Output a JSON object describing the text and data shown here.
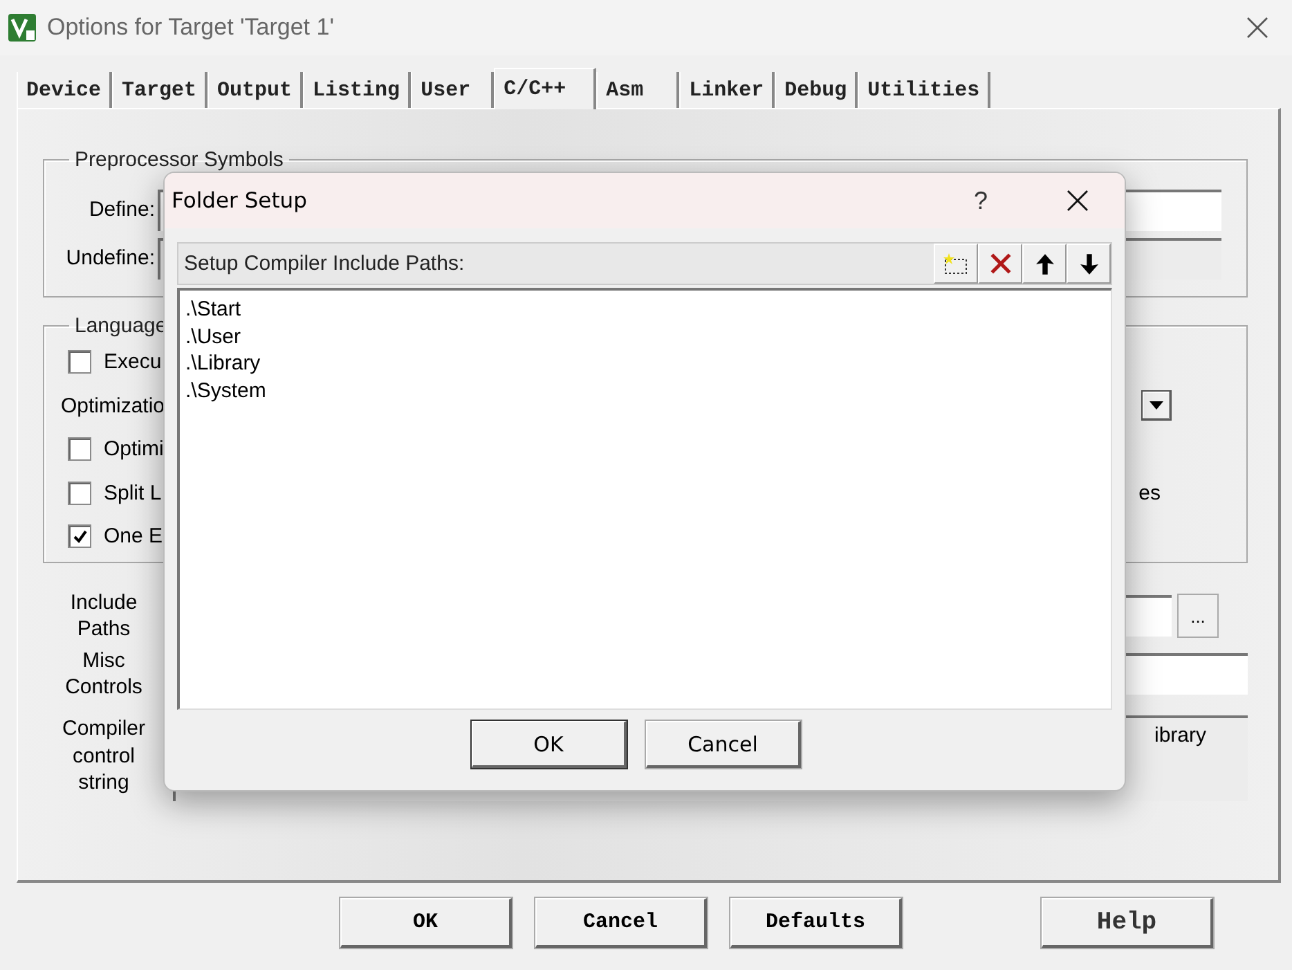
{
  "window": {
    "title": "Options for Target 'Target 1'"
  },
  "tabs": [
    {
      "label": "Device",
      "selected": false
    },
    {
      "label": "Target",
      "selected": false
    },
    {
      "label": "Output",
      "selected": false
    },
    {
      "label": "Listing",
      "selected": false
    },
    {
      "label": "User",
      "selected": false
    },
    {
      "label": "C/C++",
      "selected": true
    },
    {
      "label": "Asm",
      "selected": false
    },
    {
      "label": "Linker",
      "selected": false
    },
    {
      "label": "Debug",
      "selected": false
    },
    {
      "label": "Utilities",
      "selected": false
    }
  ],
  "preprocessor_symbols": {
    "title": "Preprocessor Symbols",
    "define_label": "Define:",
    "undefine_label": "Undefine:"
  },
  "language": {
    "title": "Language",
    "optimization_label": "Optimizatio",
    "right_text": "es",
    "checkboxes": [
      {
        "label": "Execu",
        "checked": false
      },
      {
        "label": "Optimi",
        "checked": false
      },
      {
        "label": "Split L",
        "checked": false
      },
      {
        "label": "One E",
        "checked": true
      }
    ]
  },
  "include_paths": {
    "label": "Include Paths",
    "browse": "..."
  },
  "misc_controls": {
    "label": "Misc Controls"
  },
  "compiler_control_string": {
    "label": "Compiler control string",
    "value_tail": "ibrary"
  },
  "buttons": [
    "OK",
    "Cancel",
    "Defaults",
    "Help"
  ],
  "folder_setup": {
    "title": "Folder Setup",
    "help": "?",
    "header": "Setup Compiler Include Paths:",
    "paths": [
      ".\\Start",
      ".\\User",
      ".\\Library",
      ".\\System"
    ],
    "buttons": [
      "OK",
      "Cancel"
    ]
  }
}
